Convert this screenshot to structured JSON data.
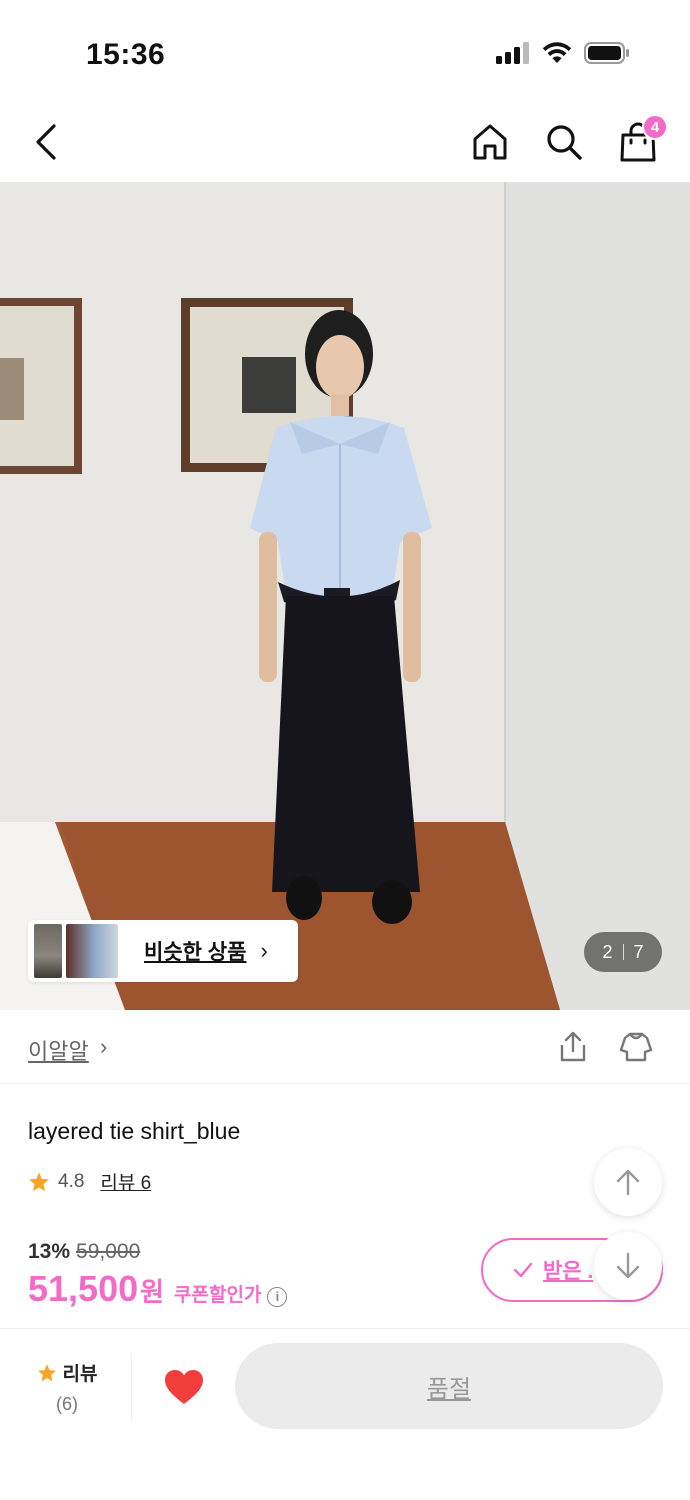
{
  "status_bar": {
    "time": "15:36",
    "icons": [
      "signal-icon",
      "wifi-icon",
      "battery-icon"
    ]
  },
  "nav": {
    "icons": [
      "back-icon",
      "home-icon",
      "search-icon",
      "cart-icon"
    ],
    "cart_count": "4"
  },
  "hero": {
    "similar_label": "비슷한 상품",
    "page_current": "2",
    "page_total": "7"
  },
  "brand": {
    "name": "이알알",
    "icons": [
      "share-icon",
      "hanger-icon"
    ]
  },
  "product": {
    "title": "layered tie shirt_blue",
    "rating": "4.8",
    "review_link": "리뷰 6",
    "discount": "13%",
    "original_price": "59,000",
    "price": "51,500",
    "price_unit": "원",
    "coupon_price_label": "쿠폰할인가",
    "coupon_button_label": "받은 ."
  },
  "bottom_bar": {
    "review_label": "리뷰",
    "review_count": "(6)",
    "soldout_label": "품절"
  },
  "colors": {
    "accent": "#f36ac8",
    "star": "#f6a623",
    "heart": "#f23d3d"
  }
}
